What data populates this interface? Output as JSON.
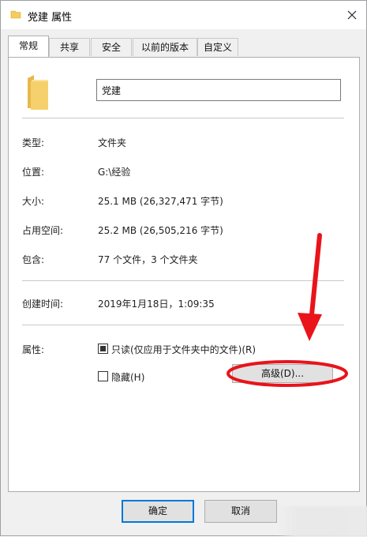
{
  "window": {
    "title": "党建 属性",
    "close_glyph": "✕"
  },
  "tabs": [
    {
      "label": "常规",
      "active": true
    },
    {
      "label": "共享",
      "active": false
    },
    {
      "label": "安全",
      "active": false
    },
    {
      "label": "以前的版本",
      "active": false
    },
    {
      "label": "自定义",
      "active": false
    }
  ],
  "general": {
    "folder_name": "党建",
    "rows": [
      {
        "label": "类型:",
        "value": "文件夹"
      },
      {
        "label": "位置:",
        "value": "G:\\经验"
      },
      {
        "label": "大小:",
        "value": "25.1 MB (26,327,471 字节)"
      },
      {
        "label": "占用空间:",
        "value": "25.2 MB (26,505,216 字节)"
      },
      {
        "label": "包含:",
        "value": "77 个文件，3 个文件夹"
      }
    ],
    "created_label": "创建时间:",
    "created_value": "2019年1月18日，1:09:35",
    "attributes_label": "属性:",
    "readonly_label": "只读(仅应用于文件夹中的文件)(R)",
    "readonly_state": "indeterminate",
    "hidden_label": "隐藏(H)",
    "hidden_checked": false,
    "advanced_button": "高级(D)..."
  },
  "footer": {
    "ok": "确定",
    "cancel": "取消"
  },
  "colors": {
    "accent": "#0078d7",
    "annotation_red": "#e8141a",
    "folder_yellow": "#f2c75c"
  },
  "icons": {
    "title_icon": "folder-icon",
    "large_icon": "folder-icon",
    "close": "close-icon"
  }
}
